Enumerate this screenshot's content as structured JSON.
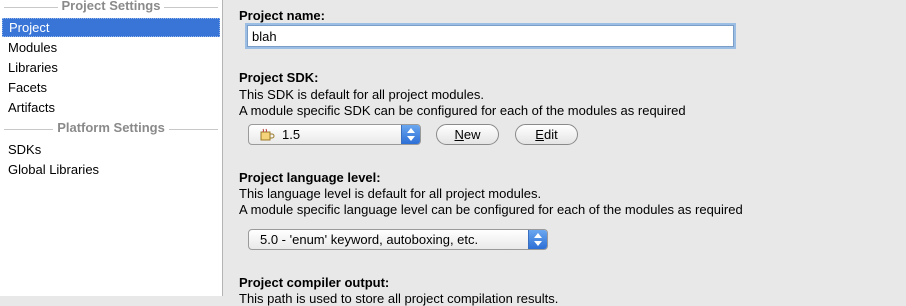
{
  "sidebar": {
    "project_settings_header": "Project Settings",
    "project_settings_items": [
      {
        "label": "Project",
        "selected": true
      },
      {
        "label": "Modules"
      },
      {
        "label": "Libraries"
      },
      {
        "label": "Facets"
      },
      {
        "label": "Artifacts"
      }
    ],
    "platform_settings_header": "Platform Settings",
    "platform_settings_items": [
      {
        "label": "SDKs"
      },
      {
        "label": "Global Libraries"
      }
    ]
  },
  "main": {
    "project_name": {
      "label": "Project name:",
      "value": "blah"
    },
    "project_sdk": {
      "label": "Project SDK:",
      "desc1": "This SDK is default for all project modules.",
      "desc2": "A module specific SDK can be configured for each of the modules as required",
      "selected": "1.5",
      "new_button": {
        "mnemonic": "N",
        "rest": "ew"
      },
      "edit_button": {
        "mnemonic": "E",
        "rest": "dit"
      }
    },
    "language_level": {
      "label": "Project language level:",
      "desc1": "This language level is default for all project modules.",
      "desc2": "A module specific language level can be configured for each of the modules as required",
      "selected": "5.0 - 'enum' keyword, autoboxing, etc."
    },
    "compiler_output": {
      "label": "Project compiler output:",
      "desc_partial": "This path is used to store all project compilation results."
    }
  },
  "colors": {
    "selection": "#3875d7",
    "panel_background": "#e8e8e8",
    "sidebar_background": "#ffffff"
  }
}
